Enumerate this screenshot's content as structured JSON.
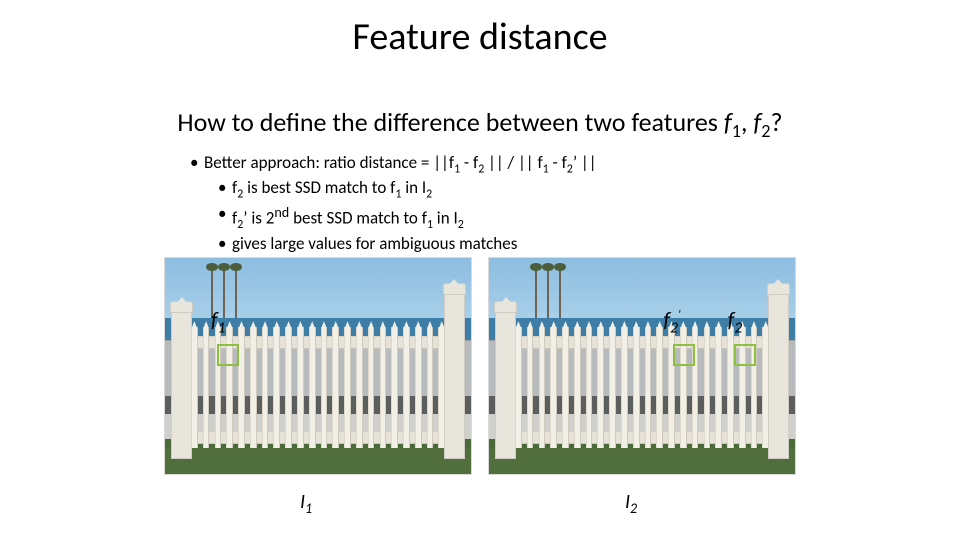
{
  "title": "Feature distance",
  "subtitle_pre": "How to define the difference between two features ",
  "subtitle_f1": "f",
  "subtitle_f1s": "1",
  "subtitle_mid": ", ",
  "subtitle_f2": "f",
  "subtitle_f2s": "2",
  "subtitle_q": "?",
  "bullets": {
    "b0_pre": "Better approach:  ratio distance = ||f",
    "b0_s1": "1",
    "b0_m1": " - f",
    "b0_s2": "2",
    "b0_m2": " || / || f",
    "b0_s3": "1",
    "b0_m3": " - f",
    "b0_s4": "2",
    "b0_prime": "’",
    "b0_end": " ||",
    "b1_pre": "f",
    "b1_s": "2",
    "b1_mid": " is best SSD match to f",
    "b1_s2": "1",
    "b1_mid2": " in I",
    "b1_s3": "2",
    "b2_pre": "f",
    "b2_s": "2",
    "b2_prime": "’",
    "b2_mid": "  is  2",
    "b2_sup": "nd",
    "b2_mid2": " best SSD match to f",
    "b2_s2": "1",
    "b2_mid3": " in I",
    "b2_s3": "2",
    "b3": "gives large values for ambiguous matches"
  },
  "markers": {
    "f1": {
      "f": "f",
      "s": "1"
    },
    "f2p": {
      "f": "f",
      "s": "2",
      "prime": "'"
    },
    "f2": {
      "f": "f",
      "s": "2"
    }
  },
  "image_labels": {
    "I": "I",
    "l1": "1",
    "l2": "2"
  }
}
